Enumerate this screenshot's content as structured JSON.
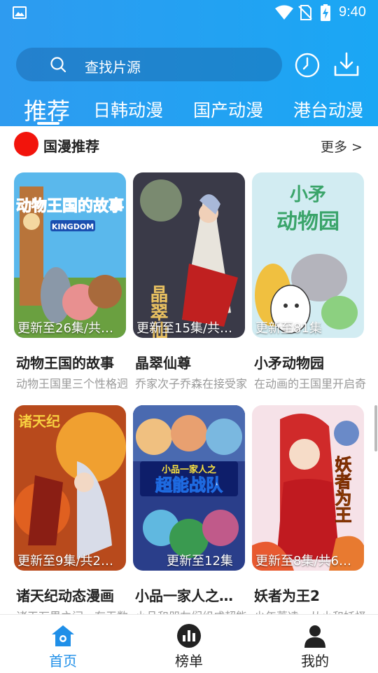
{
  "status_bar": {
    "time": "9:40"
  },
  "search": {
    "placeholder": "查找片源"
  },
  "tabs": [
    {
      "label": "推荐",
      "active": true
    },
    {
      "label": "日韩动漫",
      "active": false
    },
    {
      "label": "国产动漫",
      "active": false
    },
    {
      "label": "港台动漫",
      "active": false
    }
  ],
  "section": {
    "title": "国漫推荐",
    "more": "更多 >"
  },
  "cards": [
    {
      "title": "动物王国的故事",
      "desc": "动物王国里三个性格迥异的伙伴",
      "update": "更新至26集/共…",
      "poster_text": "动物王国的故事"
    },
    {
      "title": "晶翠仙尊",
      "desc": "乔家次子乔森在接受家族传承时",
      "update": "更新至15集/共…",
      "poster_text": "晶翠仙尊"
    },
    {
      "title": "小矛动物园",
      "desc": "在动画的王国里开启奇妙旅程",
      "update": "更新至81集",
      "poster_text": "小矛动物园"
    },
    {
      "title": "诸天纪动态漫画",
      "desc": "诸天万界之间，有无数强者",
      "update": "更新至9集/共2…",
      "poster_text": "诸天纪"
    },
    {
      "title": "小品一家人之…",
      "desc": "小品和朋友们组成超能战队",
      "update": "更新至12集",
      "poster_text": "小品一家人之 超能战队"
    },
    {
      "title": "妖者为王2",
      "desc": "少年萧凌，从小和妖怪为伴",
      "update": "更新至8集/共6…",
      "poster_text": "妖者为王"
    }
  ],
  "bottom_nav": [
    {
      "label": "首页",
      "icon": "home-icon",
      "active": true
    },
    {
      "label": "榜单",
      "icon": "ranking-icon",
      "active": false
    },
    {
      "label": "我的",
      "icon": "profile-icon",
      "active": false
    }
  ],
  "colors": {
    "header": "#1fa3f2",
    "accent": "#1f8fe8",
    "section_dot": "#f2140c"
  }
}
